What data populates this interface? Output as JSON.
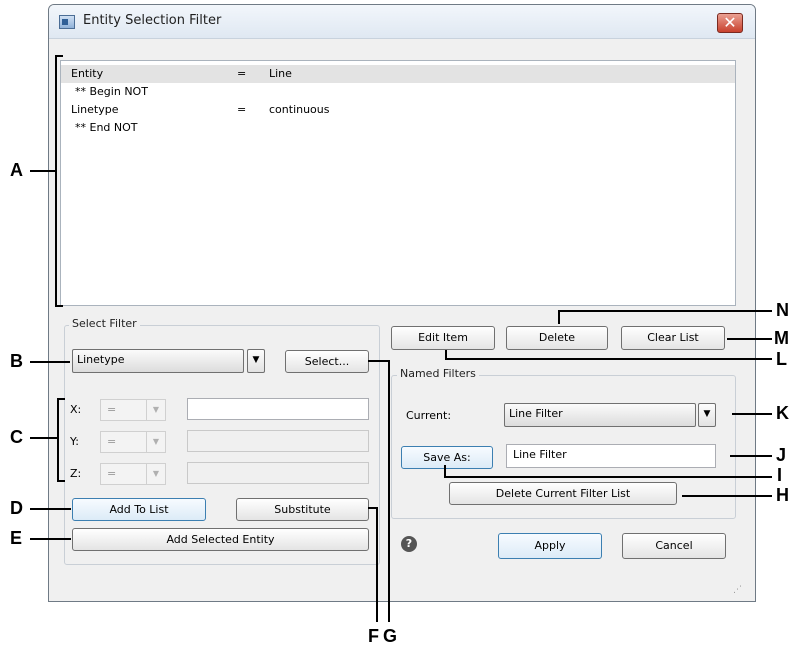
{
  "window": {
    "title": "Entity Selection Filter",
    "close_glyph": "✕"
  },
  "filter_list": {
    "rows": [
      {
        "name": "Entity",
        "op": "=",
        "value": "Line"
      },
      {
        "name": "** Begin  NOT",
        "op": "",
        "value": ""
      },
      {
        "name": "Linetype",
        "op": "=",
        "value": "continuous"
      },
      {
        "name": "** End   NOT",
        "op": "",
        "value": ""
      }
    ]
  },
  "select_filter": {
    "group_label": "Select Filter",
    "type_value": "Linetype",
    "select_button": "Select...",
    "x": {
      "label": "X:",
      "op": "=",
      "value": ""
    },
    "y": {
      "label": "Y:",
      "op": "=",
      "value": ""
    },
    "z": {
      "label": "Z:",
      "op": "=",
      "value": ""
    },
    "add_to_list": "Add To List",
    "substitute": "Substitute",
    "add_selected_entity": "Add Selected Entity"
  },
  "list_actions": {
    "edit_item": "Edit Item",
    "delete": "Delete",
    "clear_list": "Clear List"
  },
  "named_filters": {
    "group_label": "Named Filters",
    "current_label": "Current:",
    "current_value": "Line Filter",
    "save_as": "Save As:",
    "save_as_value": "Line Filter",
    "delete_current": "Delete Current Filter List"
  },
  "footer": {
    "help_glyph": "?",
    "apply": "Apply",
    "cancel": "Cancel"
  },
  "callouts": {
    "A": "A",
    "B": "B",
    "C": "C",
    "D": "D",
    "E": "E",
    "F": "F",
    "G": "G",
    "H": "H",
    "I": "I",
    "J": "J",
    "K": "K",
    "L": "L",
    "M": "M",
    "N": "N"
  }
}
